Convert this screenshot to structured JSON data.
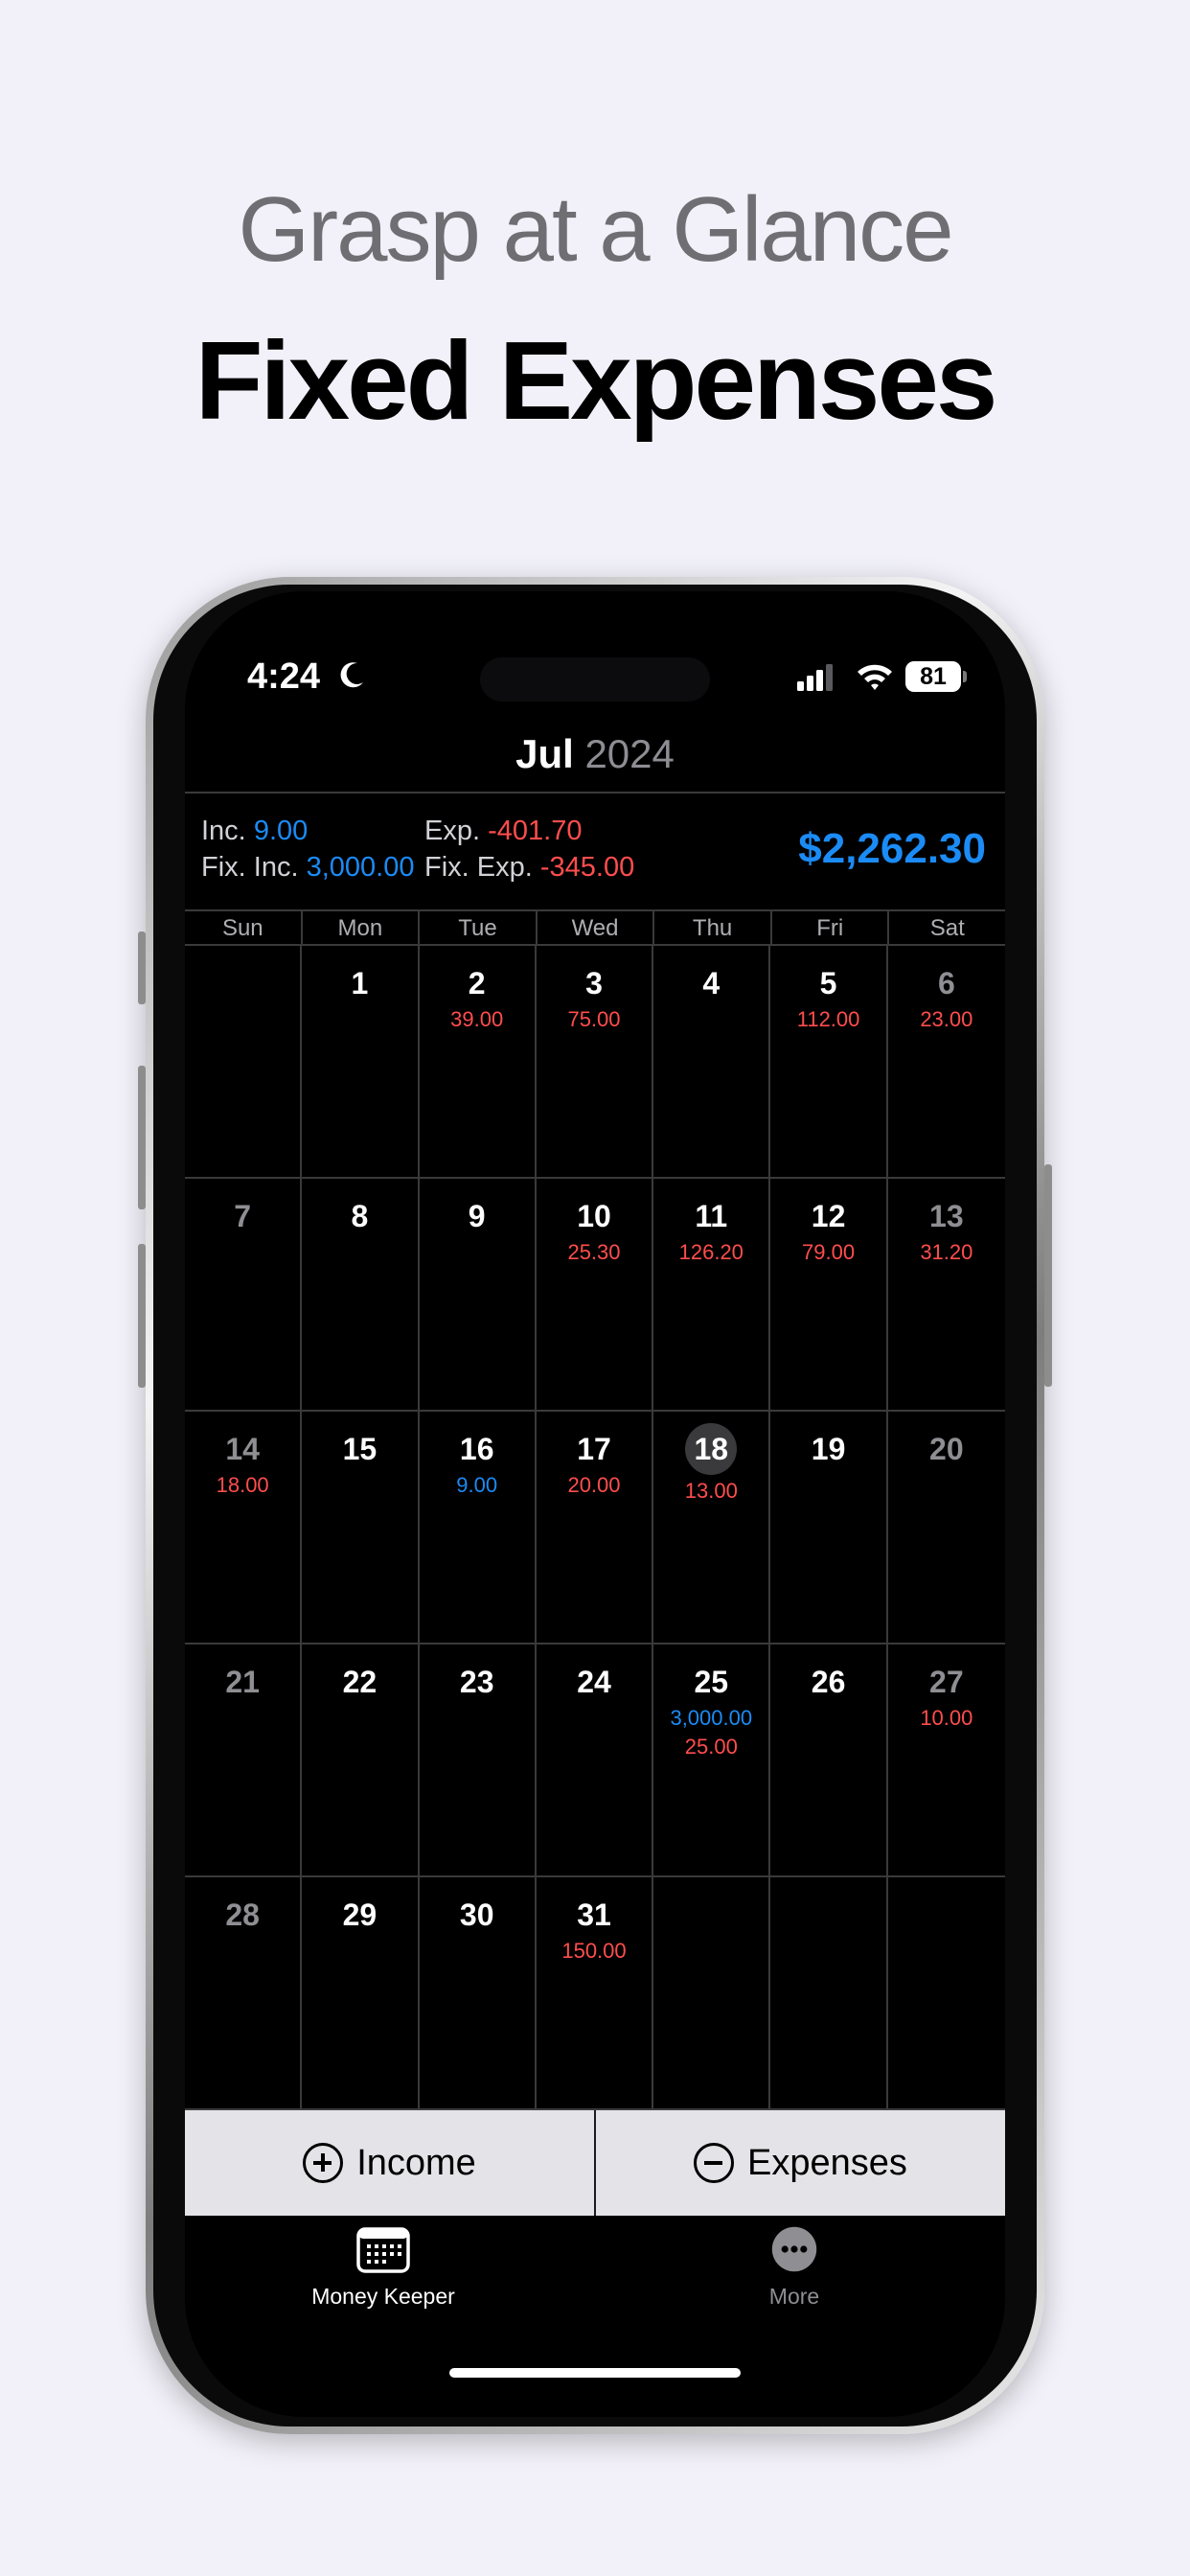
{
  "headline": {
    "top": "Grasp at a Glance",
    "main": "Fixed Expenses"
  },
  "status_bar": {
    "time": "4:24",
    "battery": "81"
  },
  "calendar": {
    "month": "Jul",
    "year": "2024",
    "summary": {
      "inc_label": "Inc.",
      "inc_value": "9.00",
      "fix_inc_label": "Fix. Inc.",
      "fix_inc_value": "3,000.00",
      "exp_label": "Exp.",
      "exp_value": "-401.70",
      "fix_exp_label": "Fix. Exp.",
      "fix_exp_value": "-345.00",
      "total": "$2,262.30"
    },
    "weekdays": [
      "Sun",
      "Mon",
      "Tue",
      "Wed",
      "Thu",
      "Fri",
      "Sat"
    ],
    "today": "18",
    "days": [
      {
        "day": "",
        "income": "",
        "expense": ""
      },
      {
        "day": "1",
        "income": "",
        "expense": ""
      },
      {
        "day": "2",
        "income": "",
        "expense": "39.00"
      },
      {
        "day": "3",
        "income": "",
        "expense": "75.00"
      },
      {
        "day": "4",
        "income": "",
        "expense": ""
      },
      {
        "day": "5",
        "income": "",
        "expense": "112.00"
      },
      {
        "day": "6",
        "income": "",
        "expense": "23.00"
      },
      {
        "day": "7",
        "income": "",
        "expense": ""
      },
      {
        "day": "8",
        "income": "",
        "expense": ""
      },
      {
        "day": "9",
        "income": "",
        "expense": ""
      },
      {
        "day": "10",
        "income": "",
        "expense": "25.30"
      },
      {
        "day": "11",
        "income": "",
        "expense": "126.20"
      },
      {
        "day": "12",
        "income": "",
        "expense": "79.00"
      },
      {
        "day": "13",
        "income": "",
        "expense": "31.20"
      },
      {
        "day": "14",
        "income": "",
        "expense": "18.00"
      },
      {
        "day": "15",
        "income": "",
        "expense": ""
      },
      {
        "day": "16",
        "income": "9.00",
        "expense": ""
      },
      {
        "day": "17",
        "income": "",
        "expense": "20.00"
      },
      {
        "day": "18",
        "income": "",
        "expense": "13.00"
      },
      {
        "day": "19",
        "income": "",
        "expense": ""
      },
      {
        "day": "20",
        "income": "",
        "expense": ""
      },
      {
        "day": "21",
        "income": "",
        "expense": ""
      },
      {
        "day": "22",
        "income": "",
        "expense": ""
      },
      {
        "day": "23",
        "income": "",
        "expense": ""
      },
      {
        "day": "24",
        "income": "",
        "expense": ""
      },
      {
        "day": "25",
        "income": "3,000.00",
        "expense": "25.00"
      },
      {
        "day": "26",
        "income": "",
        "expense": ""
      },
      {
        "day": "27",
        "income": "",
        "expense": "10.00"
      },
      {
        "day": "28",
        "income": "",
        "expense": ""
      },
      {
        "day": "29",
        "income": "",
        "expense": ""
      },
      {
        "day": "30",
        "income": "",
        "expense": ""
      },
      {
        "day": "31",
        "income": "",
        "expense": "150.00"
      },
      {
        "day": "",
        "income": "",
        "expense": ""
      },
      {
        "day": "",
        "income": "",
        "expense": ""
      },
      {
        "day": "",
        "income": "",
        "expense": ""
      }
    ]
  },
  "actions": {
    "income_label": "Income",
    "expenses_label": "Expenses"
  },
  "tabs": [
    {
      "label": "Money Keeper",
      "icon": "calendar-icon",
      "color": "#ffffff"
    },
    {
      "label": "More",
      "icon": "more-icon",
      "color": "#8e8e93"
    }
  ],
  "colors": {
    "income": "#1b8bf5",
    "expense": "#ff4d4d",
    "background": "#f2f1f9"
  }
}
